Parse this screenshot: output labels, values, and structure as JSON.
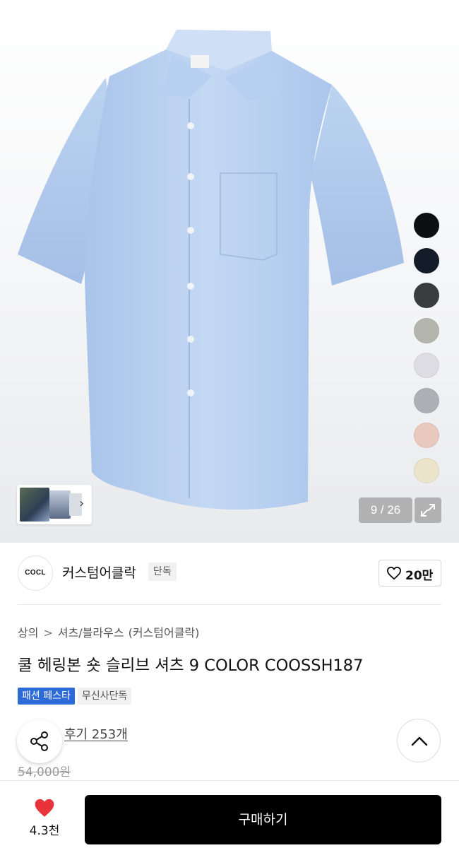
{
  "gallery": {
    "page_current": "9",
    "page_separator": "/",
    "page_total": "26",
    "page_counter": "9 / 26",
    "color_swatches": [
      "#0d0f12",
      "#141b29",
      "#3a3c3f",
      "#b4b5ad",
      "#dedde3",
      "#aeafb4",
      "#e9c9bd",
      "#ece3cb",
      "#9fb5d8"
    ]
  },
  "brand": {
    "logo_text": "COCL",
    "name": "커스텀어클락",
    "tag": "단독",
    "likes": "20만"
  },
  "product": {
    "breadcrumb": [
      "상의",
      "셔츠/블라우스"
    ],
    "breadcrumb_brand": "(커스텀어클락)",
    "title": "쿨 헤링본 숏 슬리브 셔츠 9 COLOR COOSSH187",
    "badges": [
      "패션 페스타",
      "무신사단독"
    ],
    "review_link": "후기 253개",
    "original_price": "54,000원"
  },
  "bottom_bar": {
    "wishlist_count": "4.3천",
    "buy_label": "구매하기"
  },
  "colors": {
    "accent_blue": "#2f6bd8",
    "heart_red": "#e8333a",
    "shirt_blue": "#b8d0ef"
  }
}
